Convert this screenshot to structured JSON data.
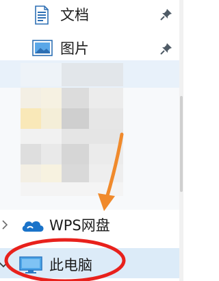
{
  "nav_tree": {
    "quick_access": [
      {
        "label": "文档",
        "icon": "document-icon",
        "pinned": true
      },
      {
        "label": "图片",
        "icon": "pictures-icon",
        "pinned": true
      }
    ],
    "wps_drive": {
      "label": "WPS网盘",
      "icon": "cloud-icon"
    },
    "this_pc": {
      "label": "此电脑",
      "icon": "monitor-icon",
      "selected": true
    }
  },
  "colors": {
    "annotation_red": "#e8211c",
    "annotation_orange": "#f08a2c",
    "selection_bg": "#dcebf8",
    "cloud_blue": "#1a73c9"
  },
  "annotations": [
    "orange-arrow-icon",
    "red-ellipse-highlight"
  ]
}
